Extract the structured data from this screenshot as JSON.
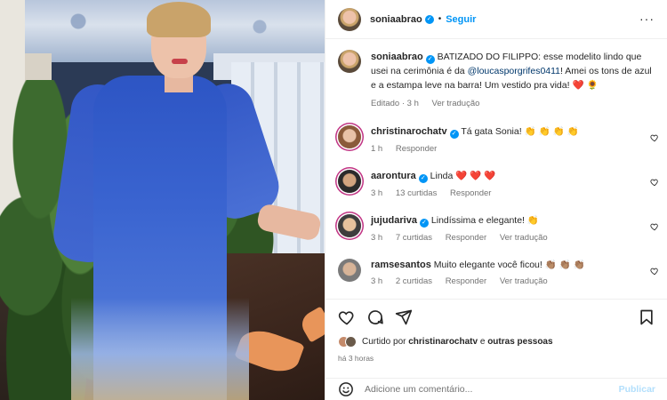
{
  "header": {
    "username": "soniaabrao",
    "separator": "•",
    "follow_label": "Seguir",
    "more_icon": "more-horizontal-icon"
  },
  "caption": {
    "username": "soniaabrao",
    "text_before": "BATIZADO DO FILIPPO: esse modelito lindo que usei na cerimônia é da ",
    "mention": "@loucasporgrifes0411",
    "text_after": "! Amei os tons de azul e a estampa leve na barra! Um vestido pra vida! ",
    "emoji": "❤️ 🌻",
    "edited": "Editado · 3 h",
    "translate": "Ver tradução"
  },
  "comments": [
    {
      "username": "christinarochatv",
      "text": "Tá gata Sonia!",
      "emoji": "👏 👏 👏 👏",
      "time": "1 h",
      "likes": "",
      "reply": "Responder",
      "translate": ""
    },
    {
      "username": "aarontura",
      "text": "Linda",
      "emoji": "❤️ ❤️ ❤️",
      "time": "3 h",
      "likes": "13 curtidas",
      "reply": "Responder",
      "translate": ""
    },
    {
      "username": "jujudariva",
      "text": "Lindíssima e elegante!",
      "emoji": "👏",
      "time": "3 h",
      "likes": "7 curtidas",
      "reply": "Responder",
      "translate": "Ver tradução"
    },
    {
      "username": "ramsesantos",
      "text": "Muito elegante você ficou!",
      "emoji": "👏🏽 👏🏽 👏🏽",
      "time": "3 h",
      "likes": "2 curtidas",
      "reply": "Responder",
      "translate": "Ver tradução"
    }
  ],
  "likes": {
    "prefix": "Curtido por ",
    "user": "christinarochatv",
    "middle": " e ",
    "others": "outras pessoas"
  },
  "time_ago": "há 3 horas",
  "composer": {
    "placeholder": "Adicione um comentário...",
    "publish": "Publicar"
  },
  "colors": {
    "accent": "#0095f6",
    "heart": "#e0245e",
    "text_secondary": "#737373"
  }
}
